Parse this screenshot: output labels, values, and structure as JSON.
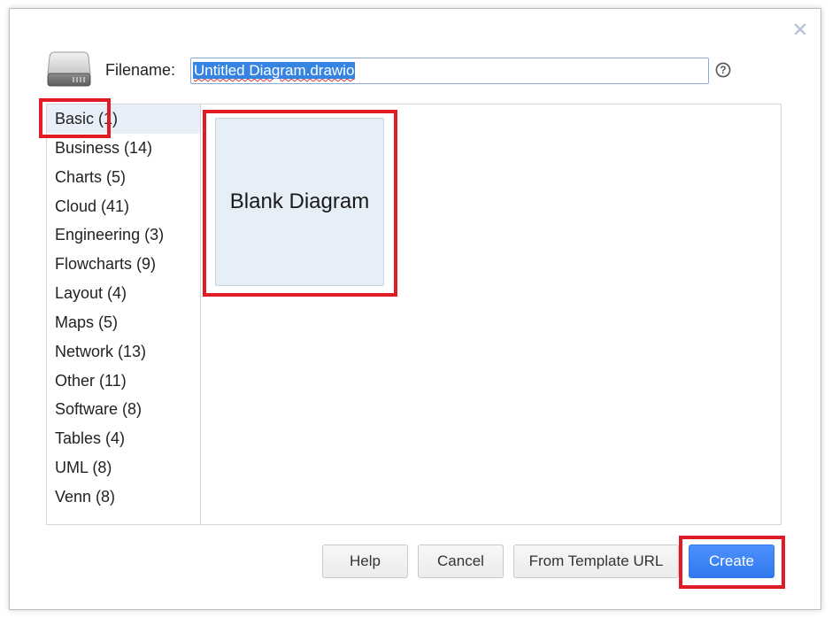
{
  "dialog": {
    "filename_label": "Filename:",
    "filename_value": "Untitled Diagram.drawio",
    "help_symbol": "?",
    "close_symbol": "×"
  },
  "categories": [
    {
      "label": "Basic (1)",
      "selected": true
    },
    {
      "label": "Business (14)"
    },
    {
      "label": "Charts (5)"
    },
    {
      "label": "Cloud (41)"
    },
    {
      "label": "Engineering (3)"
    },
    {
      "label": "Flowcharts (9)"
    },
    {
      "label": "Layout (4)"
    },
    {
      "label": "Maps (5)"
    },
    {
      "label": "Network (13)"
    },
    {
      "label": "Other (11)"
    },
    {
      "label": "Software (8)"
    },
    {
      "label": "Tables (4)"
    },
    {
      "label": "UML (8)"
    },
    {
      "label": "Venn (8)"
    }
  ],
  "templates": [
    {
      "label": "Blank Diagram"
    }
  ],
  "buttons": {
    "help": "Help",
    "cancel": "Cancel",
    "from_template_url": "From Template URL",
    "create": "Create"
  },
  "icons": {
    "disk": "hard-disk-icon",
    "help": "question-circle-icon",
    "close": "close-icon"
  },
  "colors": {
    "primary": "#3079ed",
    "selection": "#3584e4",
    "highlight": "#e01b24",
    "selected_row": "#e9eff8",
    "tile": "#e6eef8"
  }
}
